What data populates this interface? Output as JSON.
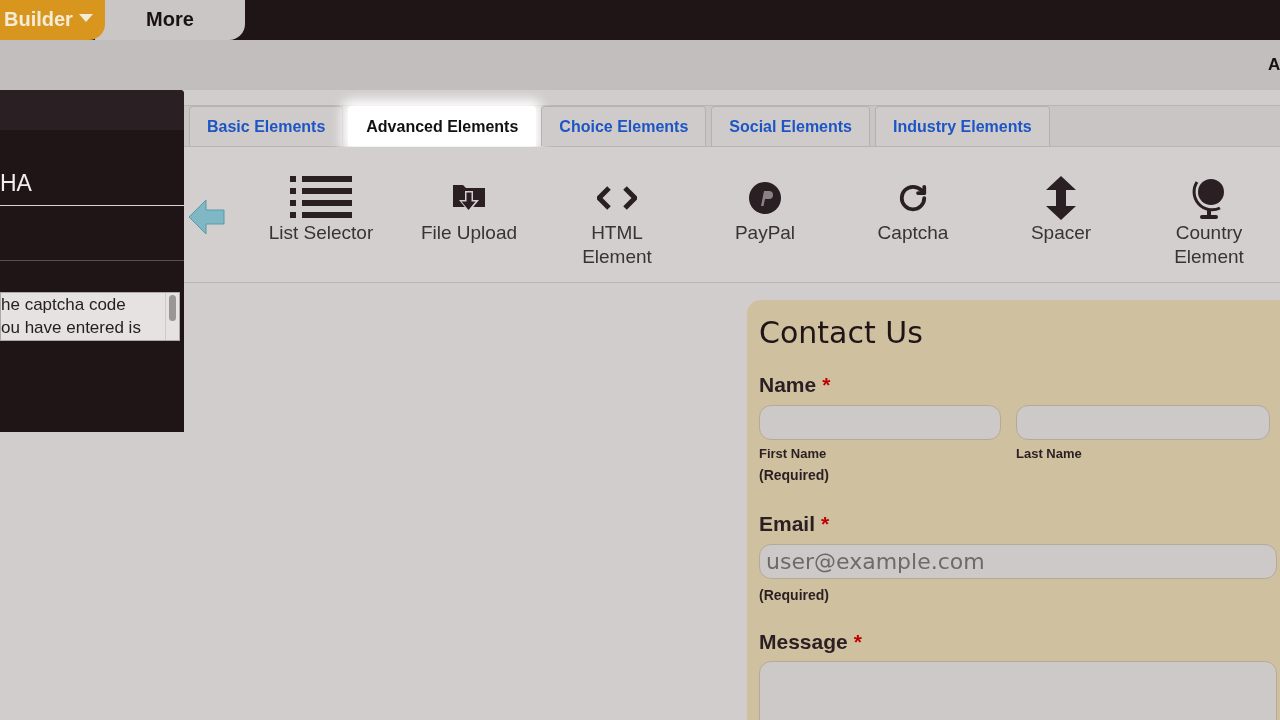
{
  "top_nav": [
    {
      "label": "Builder",
      "selected": true,
      "has_menu": true
    },
    {
      "label": "More",
      "selected": false,
      "has_menu": false
    }
  ],
  "header_right": "A",
  "side_panel": {
    "heading": "HA",
    "text_lines": [
      "he captcha code",
      "ou have entered is"
    ]
  },
  "tabs": [
    {
      "label": "Basic Elements",
      "selected": false
    },
    {
      "label": "Advanced Elements",
      "selected": true
    },
    {
      "label": "Choice Elements",
      "selected": false
    },
    {
      "label": "Social Elements",
      "selected": false
    },
    {
      "label": "Industry Elements",
      "selected": false
    }
  ],
  "elements": [
    {
      "kind": "list",
      "label": "List Selector"
    },
    {
      "kind": "upload",
      "label": "File Upload"
    },
    {
      "kind": "code",
      "label": "HTML Element"
    },
    {
      "kind": "paypal",
      "label": "PayPal"
    },
    {
      "kind": "captcha",
      "label": "Captcha"
    },
    {
      "kind": "spacer",
      "label": "Spacer"
    },
    {
      "kind": "globe",
      "label": "Country Element"
    }
  ],
  "form": {
    "title": "Contact Us",
    "fields": [
      {
        "kind": "name",
        "label": "Name",
        "marker": "*",
        "subfields": [
          {
            "sublabel": "First Name",
            "note": "(Required)"
          },
          {
            "sublabel": "Last Name"
          }
        ]
      },
      {
        "kind": "email",
        "label": "Email",
        "marker": "*",
        "placeholder": "user@example.com",
        "note": "(Required)"
      },
      {
        "kind": "textarea",
        "label": "Message",
        "marker": "*"
      }
    ]
  }
}
